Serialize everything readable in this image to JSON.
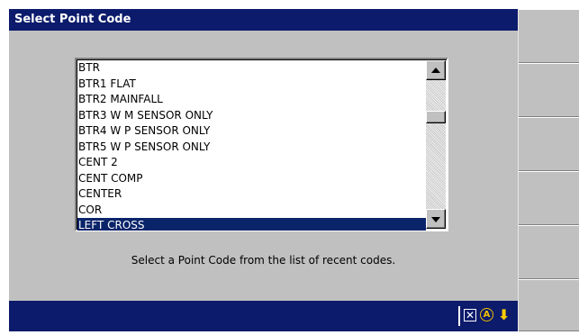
{
  "window": {
    "title": "Select Point Code"
  },
  "list": {
    "items": [
      {
        "label": "BTR",
        "selected": false
      },
      {
        "label": "BTR1 FLAT",
        "selected": false
      },
      {
        "label": "BTR2 MAINFALL",
        "selected": false
      },
      {
        "label": "BTR3 W M SENSOR ONLY",
        "selected": false
      },
      {
        "label": "BTR4 W P SENSOR ONLY",
        "selected": false
      },
      {
        "label": "BTR5 W P SENSOR ONLY",
        "selected": false
      },
      {
        "label": "CENT 2",
        "selected": false
      },
      {
        "label": "CENT COMP",
        "selected": false
      },
      {
        "label": "CENTER",
        "selected": false
      },
      {
        "label": "COR",
        "selected": false
      },
      {
        "label": "LEFT CROSS",
        "selected": true
      }
    ],
    "selected_label": "LEFT CROSS"
  },
  "instruction": "Select a Point Code from the list of recent codes.",
  "status_icons": [
    "close-box-icon",
    "alpha-mode-icon",
    "down-arrow-icon"
  ],
  "softkeys": [
    "",
    "",
    "",
    "",
    "",
    ""
  ],
  "colors": {
    "titlebar": "#0c1b6b",
    "selection": "#0a246a",
    "face": "#c0c0c0",
    "icon_accent": "#ffcc00"
  }
}
